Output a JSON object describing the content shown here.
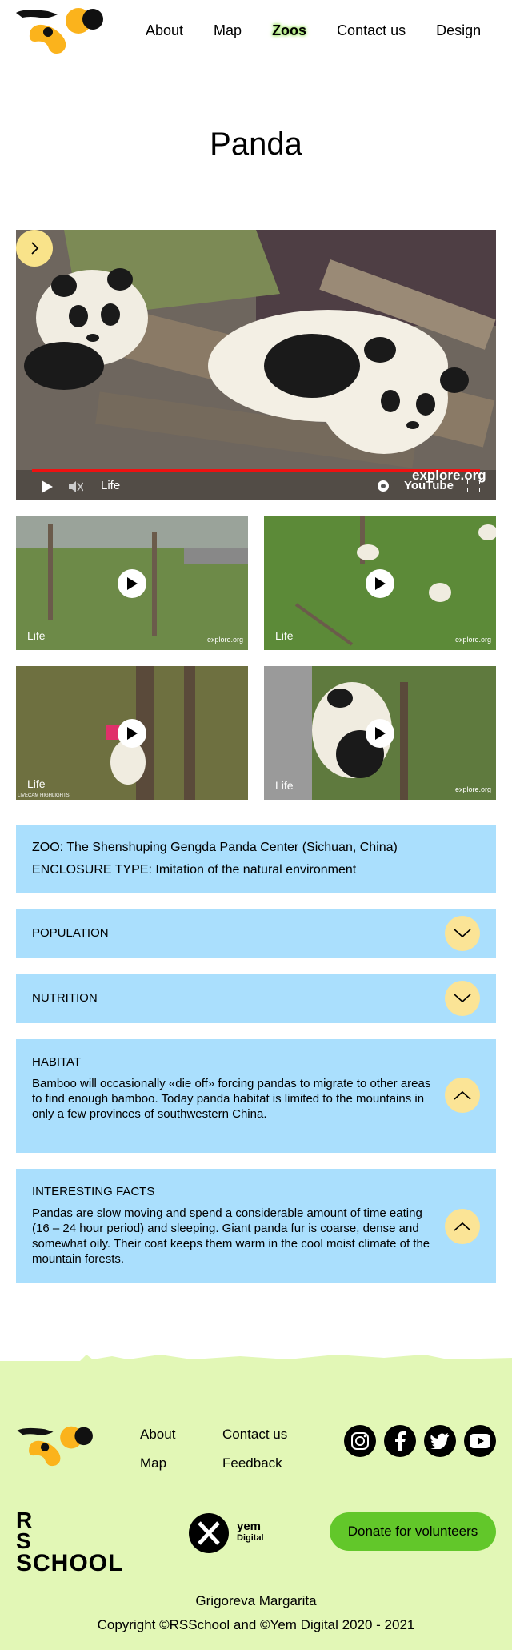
{
  "header": {
    "nav": [
      {
        "label": "About",
        "active": false
      },
      {
        "label": "Map",
        "active": false
      },
      {
        "label": "Zoos",
        "active": true
      },
      {
        "label": "Contact us",
        "active": false
      },
      {
        "label": "Design",
        "active": false
      }
    ]
  },
  "page_title": "Panda",
  "video": {
    "live_label": "Life",
    "brand": "explore.org",
    "platform": "YouTube"
  },
  "thumbnails": [
    {
      "live_label": "Life",
      "watermark": "explore.org"
    },
    {
      "live_label": "Life",
      "watermark": "explore.org"
    },
    {
      "live_label": "Life",
      "watermark": "LIVECAM HIGHLIGHTS"
    },
    {
      "live_label": "Life",
      "watermark": "explore.org"
    }
  ],
  "info": {
    "zoo": "ZOO: The Shenshuping Gengda Panda Center (Sichuan, China)",
    "enclosure": "ENCLOSURE TYPE: Imitation of the natural environment"
  },
  "accordions": [
    {
      "title": "POPULATION",
      "open": false,
      "text": ""
    },
    {
      "title": "NUTRITION",
      "open": false,
      "text": ""
    },
    {
      "title": "HABITAT",
      "open": true,
      "text": "Bamboo will occasionally «die off» forcing pandas to migrate to other areas to find enough bamboo. Today panda habitat is limited to the mountains in only a few provinces of southwestern China."
    },
    {
      "title": "INTERESTING FACTS",
      "open": true,
      "text": "Pandas are slow moving and spend a considerable amount of time eating (16 – 24 hour period) and sleeping. Giant panda fur is coarse, dense and somewhat oily. Their coat keeps them warm in the cool moist climate of the mountain forests."
    }
  ],
  "footer": {
    "links": [
      "About",
      "Map",
      "Contact us",
      "Feedback"
    ],
    "social": [
      "instagram-icon",
      "facebook-icon",
      "twitter-icon",
      "youtube-icon"
    ],
    "rsschool": {
      "line1": "R  S",
      "line2": "SCHOOL"
    },
    "yem": {
      "line1": "yem",
      "line2": "Digital"
    },
    "donate_label": "Donate for volunteers",
    "author": "Grigoreva Margarita",
    "copyright": "Copyright ©RSSchool and ©Yem Digital 2020 - 2021"
  },
  "colors": {
    "accent_yellow": "#fbe496",
    "info_blue": "#aadffd",
    "footer_green": "#e2f7b6",
    "donate_green": "#62c72a",
    "logo_orange": "#fbb31c"
  }
}
